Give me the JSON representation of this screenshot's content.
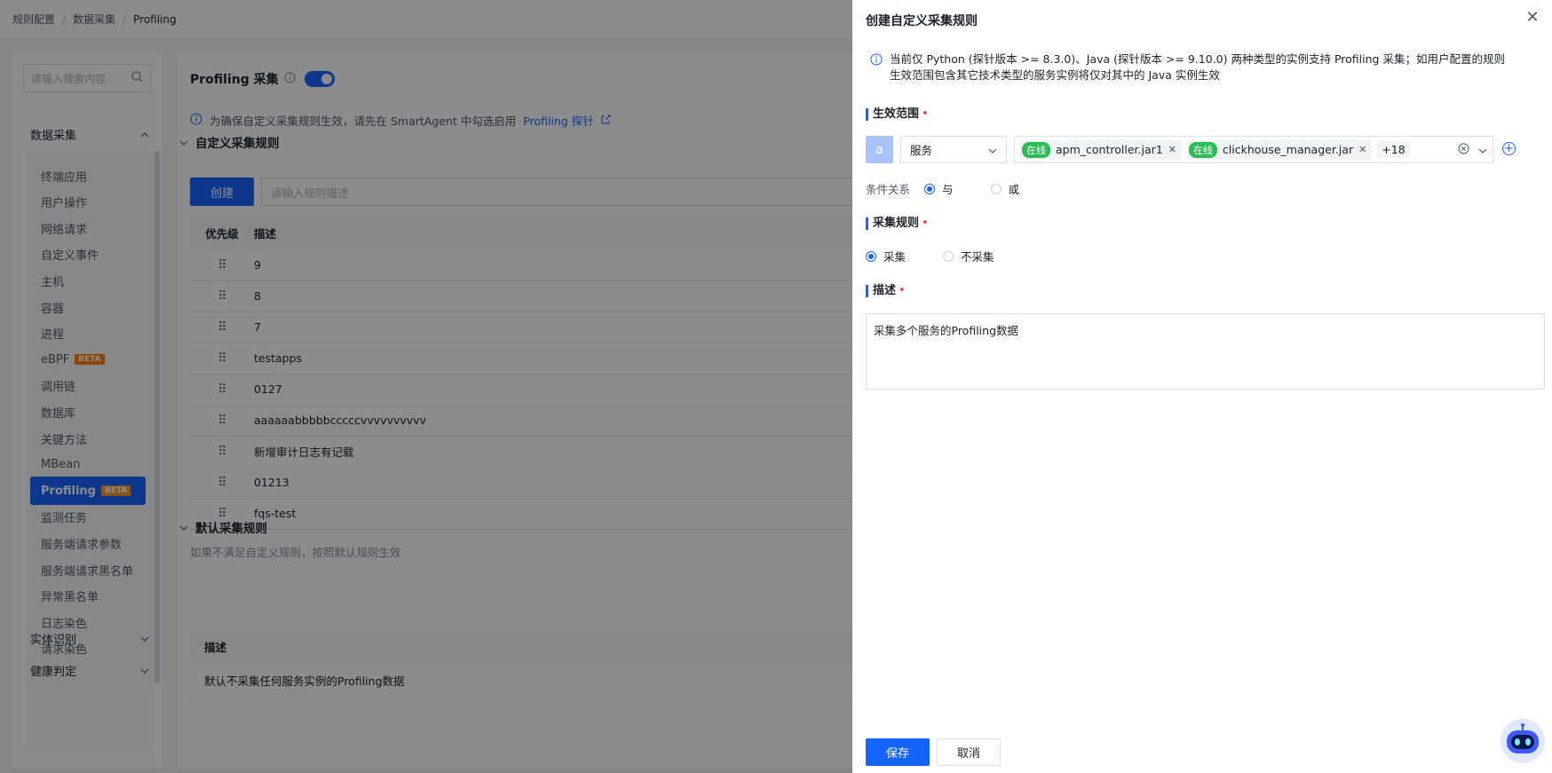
{
  "breadcrumb": [
    "规则配置",
    "数据采集",
    "Profiling"
  ],
  "sidebar": {
    "search_placeholder": "请输入搜索内容",
    "group_label": "数据采集",
    "items": [
      {
        "label": "终端应用"
      },
      {
        "label": "用户操作"
      },
      {
        "label": "网络请求"
      },
      {
        "label": "自定义事件"
      },
      {
        "label": "主机"
      },
      {
        "label": "容器"
      },
      {
        "label": "进程"
      },
      {
        "label": "eBPF",
        "badge": "BETA"
      },
      {
        "label": "调用链"
      },
      {
        "label": "数据库"
      },
      {
        "label": "关键方法"
      },
      {
        "label": "MBean"
      },
      {
        "label": "Profiling",
        "badge": "BETA",
        "active": true
      },
      {
        "label": "监测任务"
      },
      {
        "label": "服务端请求参数"
      },
      {
        "label": "服务端请求黑名单"
      },
      {
        "label": "异常黑名单"
      },
      {
        "label": "日志染色"
      },
      {
        "label": "请求染色"
      }
    ],
    "groups_collapsed": [
      "实体识别",
      "健康判定"
    ]
  },
  "main": {
    "title": "Profiling 采集",
    "toggle_on": true,
    "info_text": "为确保自定义采集规则生效，请先在 SmartAgent 中勾选启用",
    "info_link": "Profiling 探针",
    "custom_section": "自定义采集规则",
    "create_button": "创建",
    "desc_placeholder": "请输入规则描述",
    "table_headers": [
      "优先级",
      "描述"
    ],
    "rules": [
      "9",
      "8",
      "7",
      "testapps",
      "0127",
      "aaaaaabbbbbcccccvvvvvvvvvv",
      "新增审计日志有记载",
      "01213",
      "fqs-test"
    ],
    "default_section": "默认采集规则",
    "default_note": "如果不满足自定义规则，按照默认规则生效",
    "default_header": "描述",
    "default_row": "默认不采集任何服务实例的Profiling数据"
  },
  "drawer": {
    "title": "创建自定义采集规则",
    "notice": "当前仅 Python (探针版本 >= 8.3.0)、Java (探针版本 >= 9.10.0) 两种类型的实例支持 Profiling 采集；如用户配置的规则生效范围包含其它技术类型的服务实例将仅对其中的 Java 实例生效",
    "scope_title": "生效范围",
    "scope_letter": "a",
    "scope_type": "服务",
    "tags": [
      {
        "status": "在线",
        "name": "apm_controller.jar1"
      },
      {
        "status": "在线",
        "name": "clickhouse_manager.jar"
      }
    ],
    "more_count": "+18",
    "condition_label": "条件关系",
    "condition_options": [
      "与",
      "或"
    ],
    "condition_selected": "与",
    "rule_title": "采集规则",
    "rule_options": [
      "采集",
      "不采集"
    ],
    "rule_selected": "采集",
    "desc_title": "描述",
    "desc_value": "采集多个服务的Profiling数据",
    "save_button": "保存",
    "cancel_button": "取消"
  },
  "colors": {
    "primary": "#1664ff",
    "online": "#2ebc58",
    "beta": "#ff7d00"
  }
}
